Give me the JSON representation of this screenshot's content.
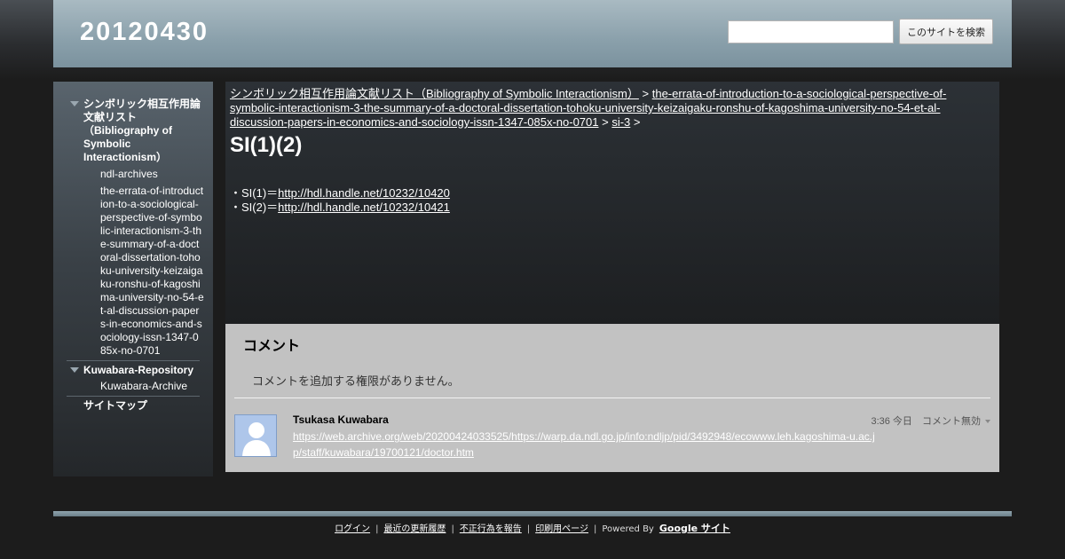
{
  "header": {
    "title": "20120430",
    "search": {
      "value": "",
      "placeholder": "",
      "button_label": "このサイトを検索"
    }
  },
  "sidebar": {
    "sections": [
      {
        "label": "シンボリック相互作用論文献リスト（Bibliography of Symbolic Interactionism）"
      },
      {
        "label": "Kuwabara-Repository"
      },
      {
        "label": "サイトマップ"
      }
    ],
    "sub_items": [
      {
        "label": "ndl-archives"
      },
      {
        "label": "the-errata-of-introduction-to-a-sociological-perspective-of-symbolic-interactionism-3-the-summary-of-a-doctoral-dissertation-tohoku-university-keizaigaku-ronshu-of-kagoshima-university-no-54-et-al-discussion-papers-in-economics-and-sociology-issn-1347-085x-no-0701"
      },
      {
        "label": "Kuwabara-Archive"
      }
    ]
  },
  "breadcrumb": {
    "items": [
      "シンボリック相互作用論文献リスト（Bibliography of Symbolic Interactionism）",
      "the-errata-of-introduction-to-a-sociological-perspective-of-symbolic-interactionism-3-the-summary-of-a-doctoral-dissertation-tohoku-university-keizaigaku-ronshu-of-kagoshima-university-no-54-et-al-discussion-papers-in-economics-and-sociology-issn-1347-085x-no-0701",
      "si-3"
    ],
    "separator": ">"
  },
  "page": {
    "title": "SI(1)(2)",
    "lines": [
      {
        "prefix": "・SI(1)＝",
        "link": "http://hdl.handle.net/10232/10420"
      },
      {
        "prefix": "・SI(2)＝",
        "link": "http://hdl.handle.net/10232/10421"
      }
    ]
  },
  "comments": {
    "title": "コメント",
    "notice": "コメントを追加する権限がありません。",
    "items": [
      {
        "author": "Tsukasa Kuwabara",
        "link": "https://web.archive.org/web/20200424033525/https://warp.da.ndl.go.jp/info:ndljp/pid/3492948/ecowww.leh.kagoshima-u.ac.jp/staff/kuwabara/19700121/doctor.htm",
        "time": "3:36 今日",
        "action": "コメント無効"
      }
    ]
  },
  "footer": {
    "links": [
      "ログイン",
      "最近の更新履歴",
      "不正行為を報告",
      "印刷用ページ"
    ],
    "powered_by": "Powered By",
    "brand": "Google サイト"
  },
  "colors": {
    "header_bg": "#8aa0ab",
    "page_bg": "#1c1c1c",
    "comments_bg": "#c2c2c2",
    "link": "#ffffff"
  }
}
